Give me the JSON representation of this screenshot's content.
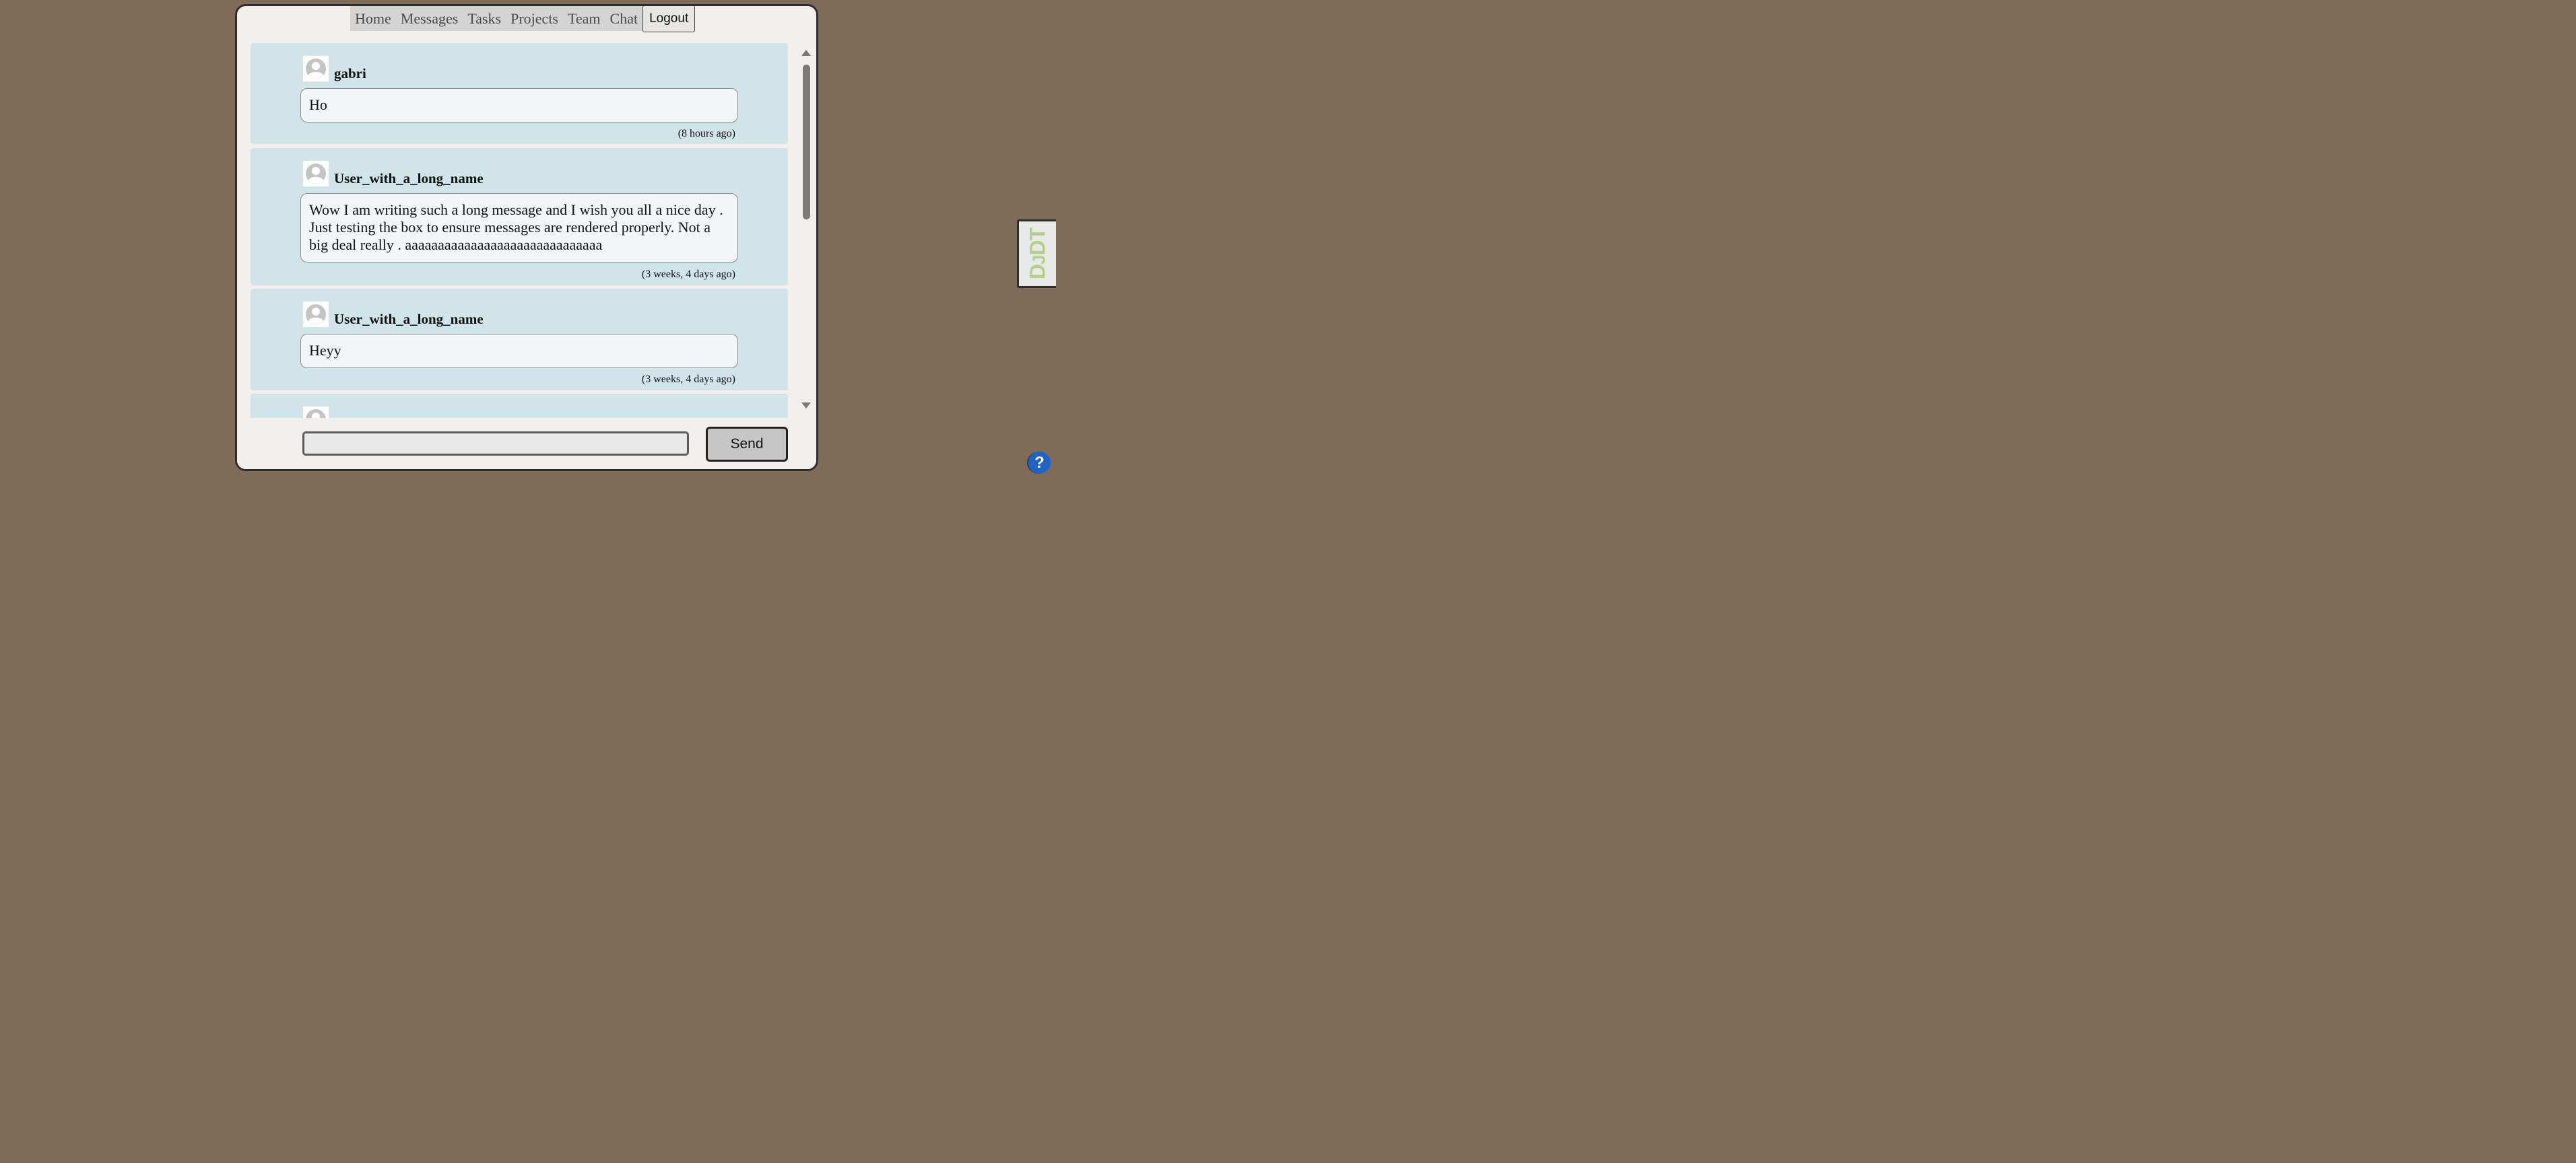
{
  "nav": {
    "links": [
      "Home",
      "Messages",
      "Tasks",
      "Projects",
      "Team",
      "Chat"
    ],
    "logout_label": "Logout"
  },
  "messages": [
    {
      "username": "gabri",
      "text": "Ho",
      "time": "(8 hours ago)"
    },
    {
      "username": "User_with_a_long_name",
      "text": "Wow I am writing such a long message and I wish you all a nice day . Just testing the box to ensure messages are rendered properly. Not a big deal really . aaaaaaaaaaaaaaaaaaaaaaaaaaaaaa",
      "time": "(3 weeks, 4 days ago)"
    },
    {
      "username": "User_with_a_long_name",
      "text": "Heyy",
      "time": "(3 weeks, 4 days ago)"
    }
  ],
  "composer": {
    "input_value": "",
    "send_label": "Send"
  },
  "debug_toolbar": {
    "label_d": "D",
    "label_j": "J",
    "label_dt": "DT"
  },
  "help": {
    "label": "?"
  },
  "colors": {
    "page_bg": "#806b58",
    "app_bg": "#f2efec",
    "card_bg": "#d1e4ea",
    "bubble_bg": "#f3f6f8",
    "help_blue": "#1f63c6",
    "djdt_green": "#b3d18b"
  }
}
